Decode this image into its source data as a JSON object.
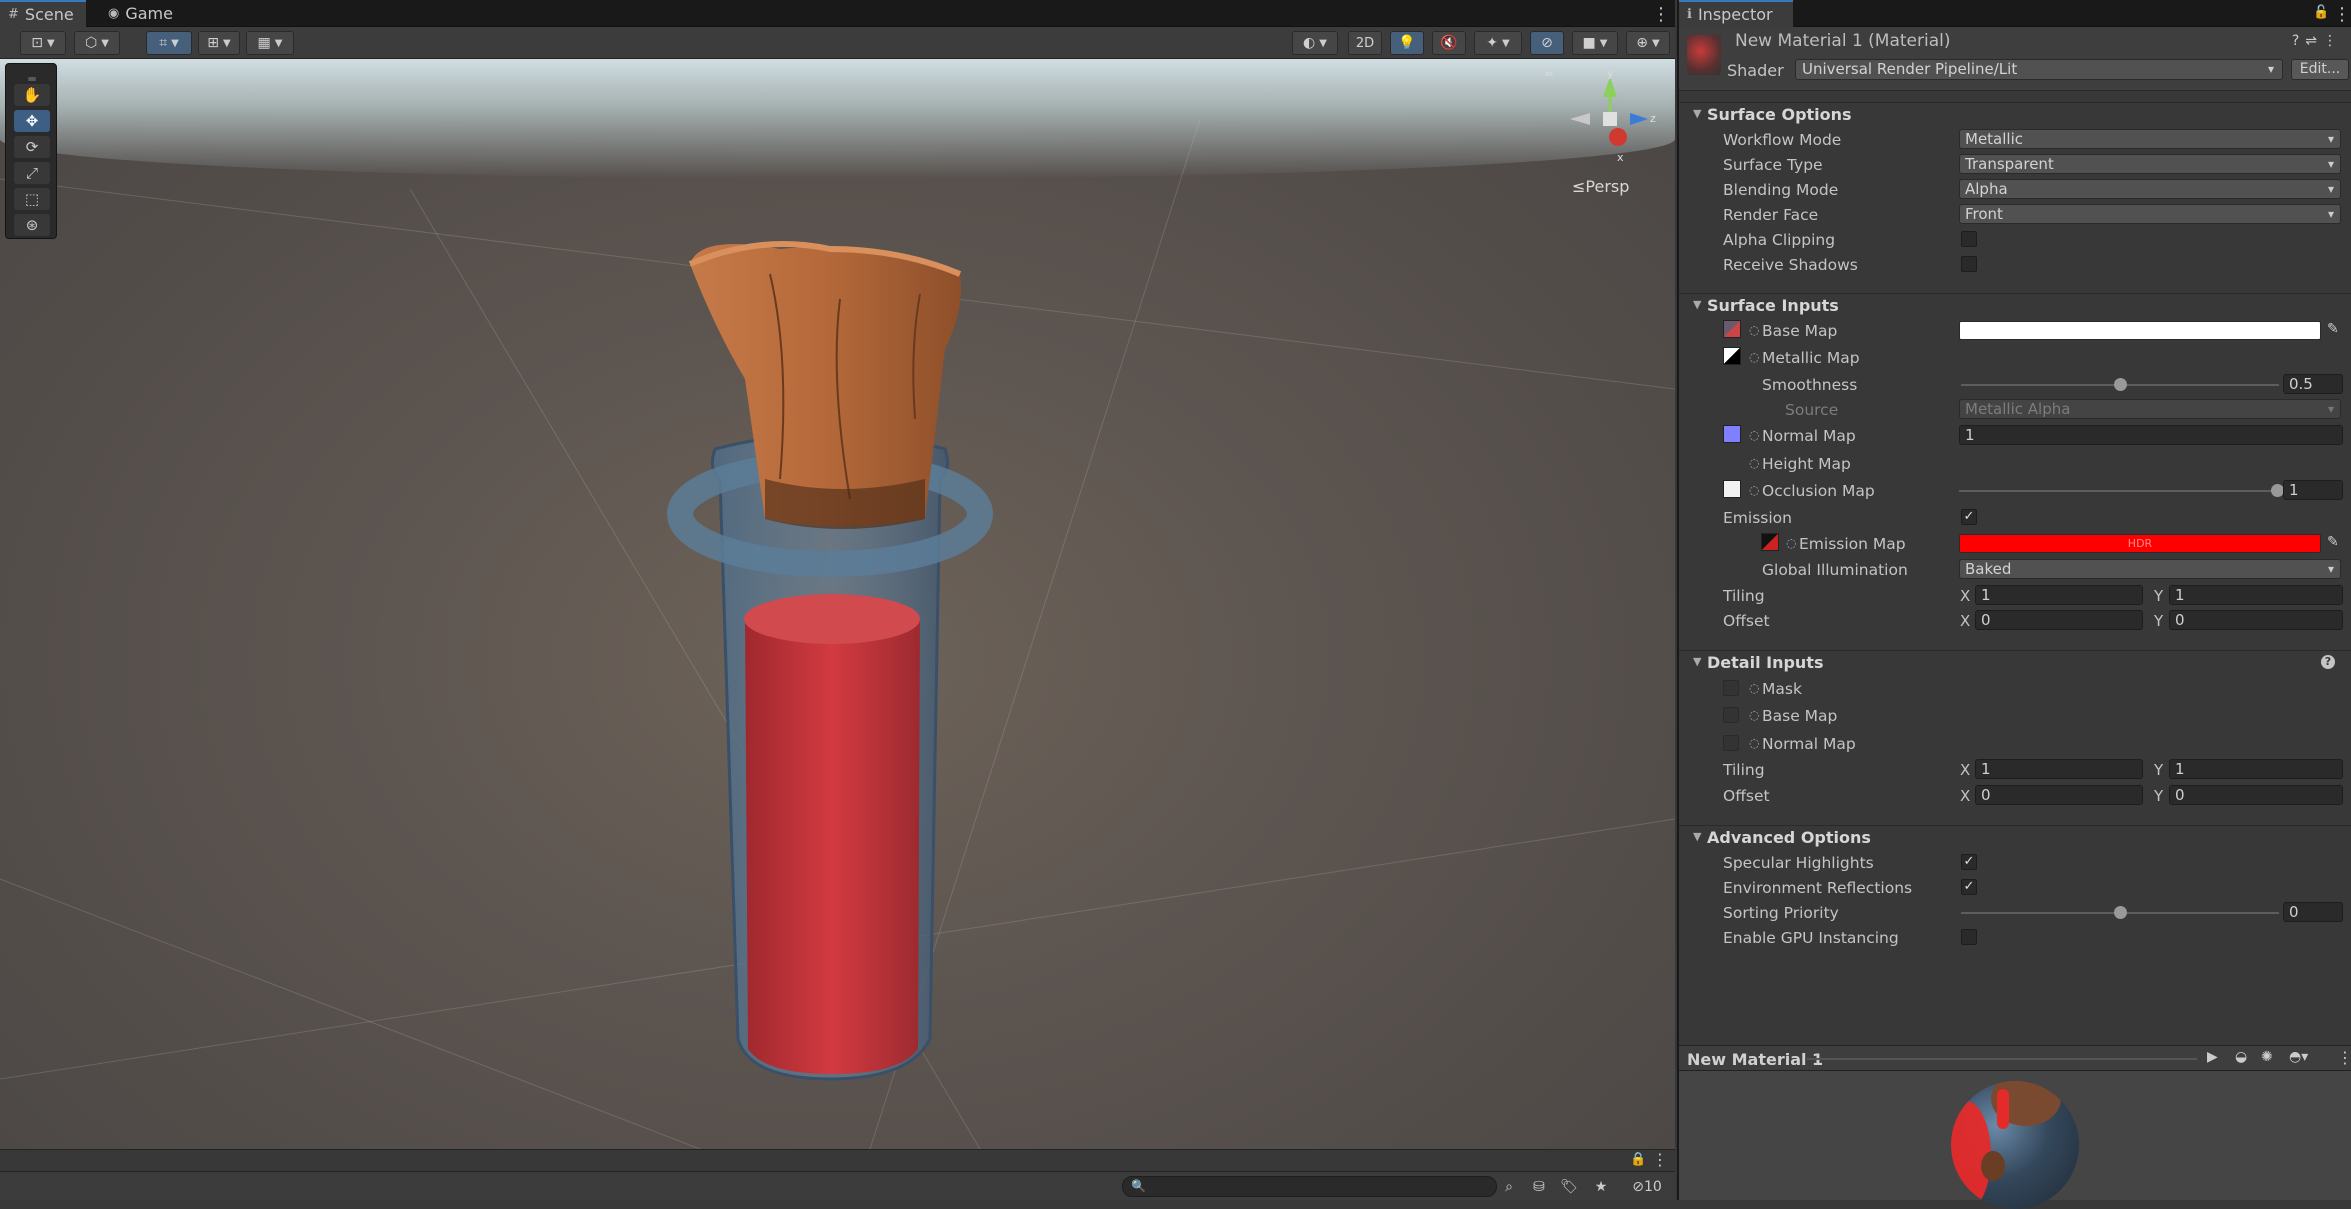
{
  "scene_tabs": [
    {
      "label": "Scene",
      "icon": "scene-grid-icon",
      "active": true
    },
    {
      "label": "Game",
      "icon": "gamepad-icon",
      "active": false
    }
  ],
  "scene_toolbar": {
    "two_d_label": "2D",
    "persp_label": "Persp"
  },
  "bottom_bar": {
    "search_placeholder": "",
    "hidden_count": "10"
  },
  "inspector": {
    "tab_label": "Inspector",
    "material_title": "New Material 1 (Material)",
    "shader_label": "Shader",
    "shader_value": "Universal Render Pipeline/Lit",
    "edit_label": "Edit...",
    "surface_options": {
      "title": "Surface Options",
      "workflow_mode": {
        "label": "Workflow Mode",
        "value": "Metallic"
      },
      "surface_type": {
        "label": "Surface Type",
        "value": "Transparent"
      },
      "blending_mode": {
        "label": "Blending Mode",
        "value": "Alpha"
      },
      "render_face": {
        "label": "Render Face",
        "value": "Front"
      },
      "alpha_clipping": {
        "label": "Alpha Clipping",
        "checked": false
      },
      "receive_shadows": {
        "label": "Receive Shadows",
        "checked": false
      }
    },
    "surface_inputs": {
      "title": "Surface Inputs",
      "base_map": {
        "label": "Base Map",
        "color": "#ffffff"
      },
      "metallic_map": {
        "label": "Metallic Map"
      },
      "smoothness": {
        "label": "Smoothness",
        "value": "0.5",
        "fraction": 0.5
      },
      "source": {
        "label": "Source",
        "value": "Metallic Alpha"
      },
      "normal_map": {
        "label": "Normal Map",
        "value": "1"
      },
      "height_map": {
        "label": "Height Map"
      },
      "occlusion_map": {
        "label": "Occlusion Map",
        "value": "1",
        "fraction": 1.0
      },
      "emission": {
        "label": "Emission",
        "checked": true
      },
      "emission_map": {
        "label": "Emission Map",
        "color": "#ff0000",
        "hdr_label": "HDR"
      },
      "global_illumination": {
        "label": "Global Illumination",
        "value": "Baked"
      },
      "tiling": {
        "label": "Tiling",
        "x": "1",
        "y": "1"
      },
      "offset": {
        "label": "Offset",
        "x": "0",
        "y": "0"
      }
    },
    "detail_inputs": {
      "title": "Detail Inputs",
      "mask": {
        "label": "Mask"
      },
      "base_map": {
        "label": "Base Map"
      },
      "normal_map": {
        "label": "Normal Map"
      },
      "tiling": {
        "label": "Tiling",
        "x": "1",
        "y": "1"
      },
      "offset": {
        "label": "Offset",
        "x": "0",
        "y": "0"
      }
    },
    "advanced_options": {
      "title": "Advanced Options",
      "specular_highlights": {
        "label": "Specular Highlights",
        "checked": true
      },
      "environment_reflections": {
        "label": "Environment Reflections",
        "checked": true
      },
      "sorting_priority": {
        "label": "Sorting Priority",
        "value": "0",
        "fraction": 0.5
      },
      "gpu_instancing": {
        "label": "Enable GPU Instancing",
        "checked": false
      }
    },
    "xy_labels": {
      "x": "X",
      "y": "Y"
    },
    "preview_title": "New Material 1"
  },
  "colors": {
    "accent": "#3a79bb",
    "emission": "#ff0000",
    "potion_red": "#c9363c",
    "cork": "#b5693a"
  }
}
